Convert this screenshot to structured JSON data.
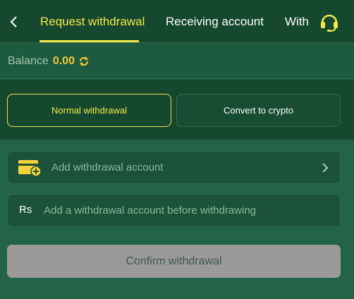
{
  "header": {
    "tabs": [
      {
        "label": "Request withdrawal",
        "active": true
      },
      {
        "label": "Receiving account",
        "active": false
      },
      {
        "label": "With",
        "active": false
      }
    ],
    "back_icon": "chevron-left-icon",
    "support_icon": "headset-icon"
  },
  "balance": {
    "label": "Balance",
    "value": "0.00",
    "refresh_icon": "refresh-icon"
  },
  "modes": {
    "normal_label": "Normal withdrawal",
    "crypto_label": "Convert to crypto",
    "selected": "Normal withdrawal"
  },
  "account": {
    "add_label": "Add withdrawal account",
    "add_icon": "wallet-add-icon",
    "currency_symbol": "Rs",
    "info_label": "Add a withdrawal account before withdrawing"
  },
  "confirm_label": "Confirm withdrawal",
  "colors": {
    "accent": "#f4e94a",
    "balance_value": "#f4c536",
    "background": "#1e5a40",
    "disabled_button": "#9a9a9a"
  }
}
